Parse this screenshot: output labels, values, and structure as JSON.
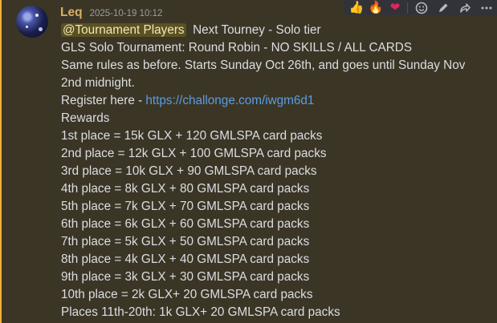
{
  "message": {
    "author": "Leq",
    "timestamp": "2025-10-19 10:12",
    "mention": "@Tournament Players",
    "first_line_after_mention": "  Next Tourney - Solo tier",
    "lines": [
      "GLS Solo Tournament: Round Robin - NO SKILLS / ALL CARDS",
      "Same rules as before. Starts Sunday Oct 26th, and goes until Sunday Nov 2nd midnight.",
      "Register here - ",
      "Rewards",
      "1st place = 15k GLX + 120 GMLSPA card packs",
      "2nd place = 12k GLX + 100 GMLSPA card packs",
      "3rd place = 10k GLX + 90 GMLSPA card packs",
      "4th place = 8k GLX + 80 GMLSPA card packs",
      "5th place = 7k GLX + 70 GMLSPA card packs",
      "6th place = 6k GLX + 60 GMLSPA card packs",
      "7th place = 5k GLX + 50 GMLSPA card packs",
      "8th place = 4k GLX + 40 GMLSPA card packs",
      "9th place = 3k GLX + 30 GMLSPA card packs",
      "10th place = 2k GLX+ 20 GMLSPA card packs",
      "Places 11th-20th: 1k GLX+ 20 GMLSPA card packs"
    ],
    "register_link": "https://challonge.com/iwgm6d1"
  },
  "reactions": [
    {
      "icon": "thumbs-up-icon",
      "glyph": "👍"
    },
    {
      "icon": "fire-icon",
      "glyph": "🔥"
    },
    {
      "icon": "heart-icon",
      "glyph": "❤"
    }
  ],
  "toolbar": [
    {
      "icon": "add-reaction-icon"
    },
    {
      "icon": "edit-icon"
    },
    {
      "icon": "forward-icon"
    },
    {
      "icon": "more-icon"
    }
  ],
  "colors": {
    "highlight_background": "#3b3526",
    "highlight_border": "#f0b232",
    "username": "#d8b062",
    "link": "#5a9ee0",
    "mention_background": "#5a5022"
  }
}
